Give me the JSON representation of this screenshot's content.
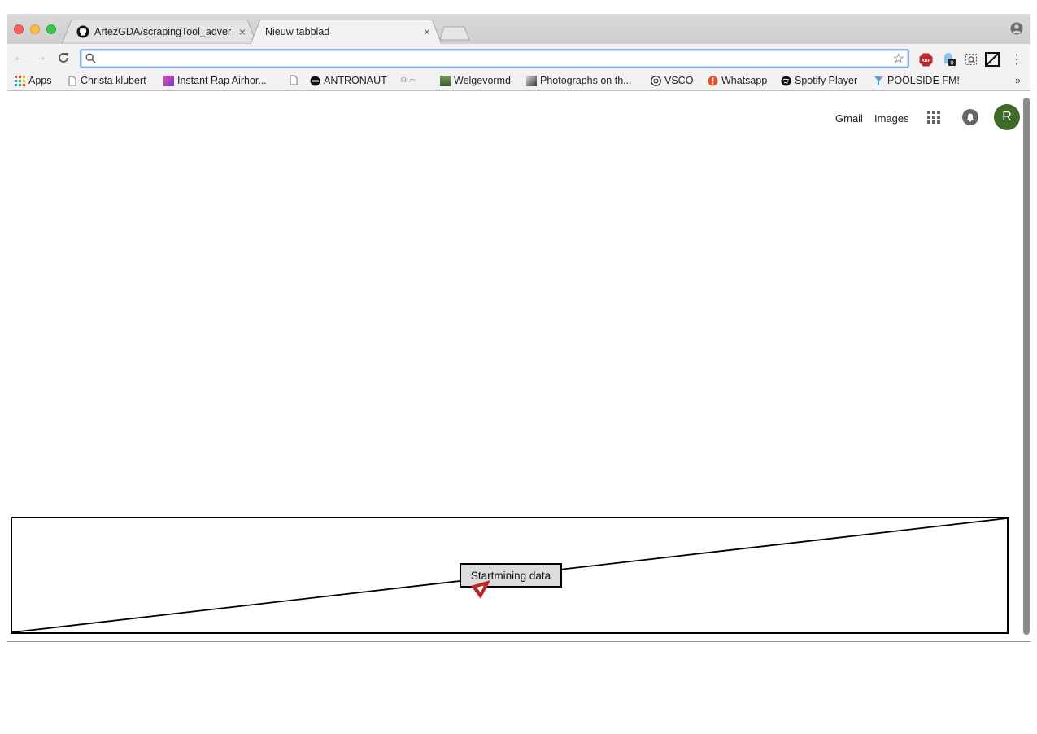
{
  "tabs": [
    {
      "title": "ArtezGDA/scrapingTool_adver",
      "close": "×",
      "icon": "github-icon"
    },
    {
      "title": "Nieuw tabblad",
      "close": "×",
      "active": true
    }
  ],
  "omnibox": {
    "value": "",
    "placeholder": ""
  },
  "bookmarks": {
    "apps": "Apps",
    "items": [
      {
        "label": "Christa klubert",
        "icon": "page-icon"
      },
      {
        "label": "Instant Rap Airhor...",
        "icon": "image-icon"
      },
      {
        "label": "",
        "icon": "page-icon"
      },
      {
        "label": "ANTRONAUT",
        "icon": "circle-icon"
      },
      {
        "label": "",
        "icon": "symbol-icon"
      },
      {
        "label": "Welgevormd",
        "icon": "image-icon"
      },
      {
        "label": "Photographs on th...",
        "icon": "image-icon"
      },
      {
        "label": "VSCO",
        "icon": "vsco-icon"
      },
      {
        "label": "Whatsapp",
        "icon": "alert-icon"
      },
      {
        "label": "Spotify Player",
        "icon": "spotify-icon"
      },
      {
        "label": "POOLSIDE FM!",
        "icon": "cocktail-icon"
      }
    ],
    "more": "»"
  },
  "google_bar": {
    "gmail": "Gmail",
    "images": "Images",
    "avatar": "R"
  },
  "page": {
    "button_label": "Startmining data"
  },
  "colors": {
    "avatar": "#3e6b2a",
    "omnibox_border": "#8ab0e8",
    "arrow": "#c0272d"
  }
}
